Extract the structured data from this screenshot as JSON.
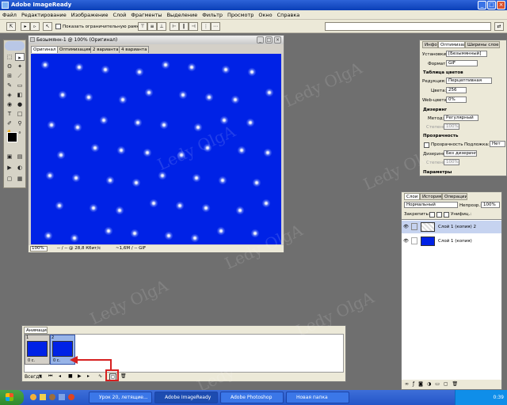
{
  "app": {
    "title": "Adobe ImageReady"
  },
  "menu": [
    "Файл",
    "Редактирование",
    "Изображение",
    "Слой",
    "Фрагменты",
    "Выделение",
    "Фильтр",
    "Просмотр",
    "Окно",
    "Справка"
  ],
  "options_bar": {
    "bounding_box_label": "Показать ограничительную рамку"
  },
  "document": {
    "title": "Безымянн-1 @ 100% (Оригинал)",
    "tabs": [
      "Оригинал",
      "Оптимизация",
      "2 варианта",
      "4 варианта"
    ],
    "canvas_color": "#0022e6",
    "status": {
      "zoom": "100%",
      "size": "-- / -- @ 28,8 Кбит/с",
      "format": "~1,6М / -- GIF"
    }
  },
  "optimize_panel": {
    "tabs": [
      "Инфо",
      "Оптимизация",
      "Ширины слоев"
    ],
    "preset_label": "Установки:",
    "preset_value": "[Безымянный]",
    "format_label": "Формат:",
    "format_value": "GIF",
    "color_table_section": "Таблица цветов",
    "reduction_label": "Редукция:",
    "reduction_value": "Перцептивная",
    "colors_label": "Цвета:",
    "colors_value": "256",
    "web_snap_label": "Web-цвета:",
    "web_snap_value": "0%",
    "dither_section": "Дизеринг",
    "method_label": "Метод:",
    "method_value": "Регулярный",
    "amount_label": "Степень:",
    "amount_value": "100%",
    "transparency_section": "Прозрачность",
    "transparency_label": "Прозрачность",
    "matte_label": "Подложка:",
    "matte_value": "Нет",
    "dither_label2": "Дизеринг:",
    "dither_value2": "Без дизеринг...",
    "amount2_label": "Степень:",
    "amount2_value": "100%",
    "params_section": "Параметры"
  },
  "layers_panel": {
    "tabs": [
      "Слои",
      "История",
      "Операции"
    ],
    "blend_mode": "Нормальный",
    "opacity_label": "Непрозр.:",
    "opacity_value": "100%",
    "lock_label": "Закрепить:",
    "unify_label": "Унифиц.:",
    "layers": [
      {
        "name": "Слой 1 (копия) 2",
        "thumbnail": "transparent"
      },
      {
        "name": "Слой 1 (копия)",
        "thumbnail": "blue"
      }
    ]
  },
  "animation_panel": {
    "title": "Анимация",
    "frames": [
      {
        "number": "1",
        "delay": "0 с."
      },
      {
        "number": "2",
        "delay": "0 с."
      }
    ],
    "loop_value": "Всегда",
    "highlight_color": "#d62020"
  },
  "watermark": "Ledy OlgA",
  "taskbar": {
    "items": [
      "Урок 20, летящие...",
      "Adobe ImageReady",
      "Adobe Photoshop",
      "Новая папка"
    ],
    "clock": "0:39"
  }
}
